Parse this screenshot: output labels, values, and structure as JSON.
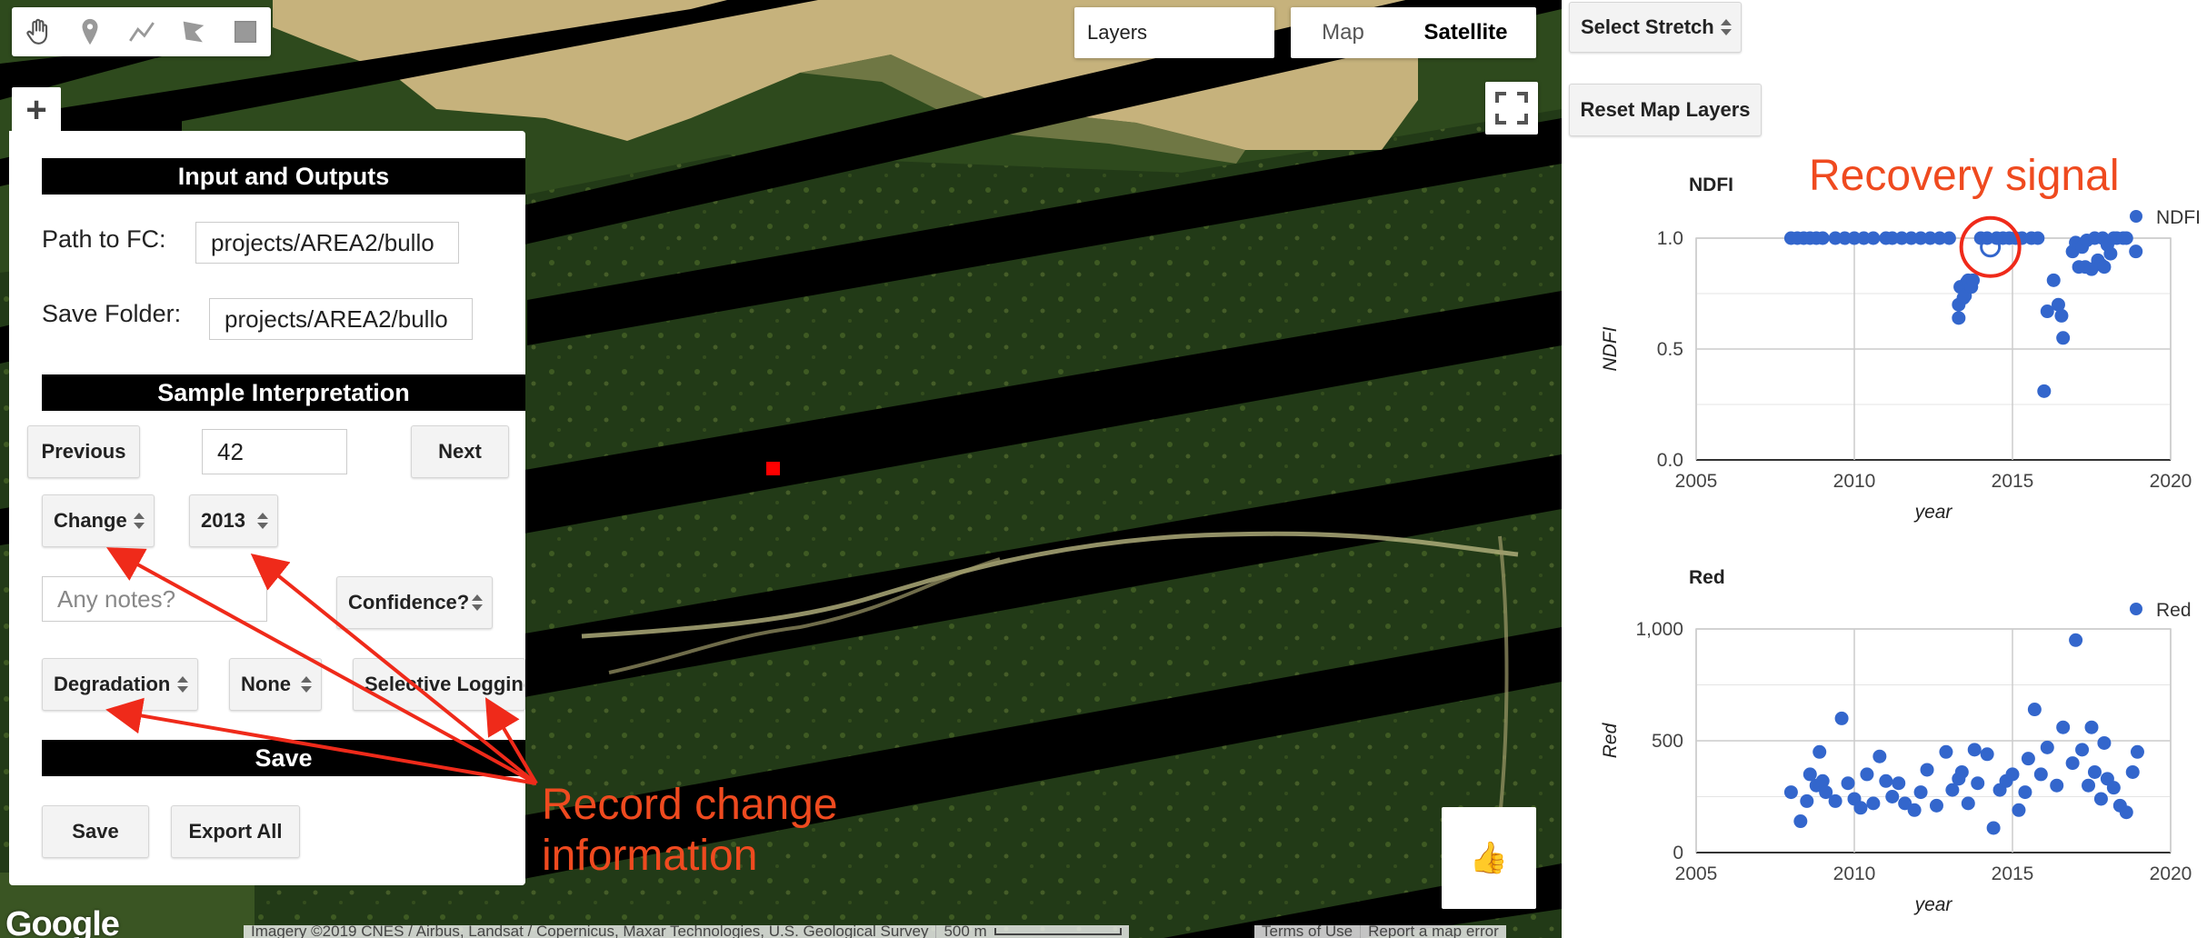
{
  "map": {
    "tools": [
      {
        "name": "hand-icon"
      },
      {
        "name": "marker-icon"
      },
      {
        "name": "line-icon"
      },
      {
        "name": "polygon-icon"
      },
      {
        "name": "rectangle-icon"
      }
    ],
    "layers_label": "Layers",
    "map_type": {
      "map_label": "Map",
      "satellite_label": "Satellite",
      "selected": "Satellite"
    },
    "plus_label": "+",
    "google_logo": "Google",
    "attribution": "Imagery ©2019 CNES / Airbus, Landsat / Copernicus, Maxar Technologies, U.S. Geological Survey",
    "scale_label": "500 m",
    "terms_label": "Terms of Use",
    "report_label": "Report a map error",
    "thumb_icon": "thumbs-up-icon"
  },
  "panel": {
    "io_header": "Input and Outputs",
    "path_label": "Path to FC:",
    "path_value": "projects/AREA2/bullo",
    "folder_label": "Save Folder:",
    "folder_value": "projects/AREA2/bullo",
    "sample_header": "Sample Interpretation",
    "prev_label": "Previous",
    "sample_index": "42",
    "next_label": "Next",
    "change_value": "Change",
    "year_value": "2013",
    "notes_placeholder": "Any notes?",
    "confidence_value": "Confidence?",
    "degradation_value": "Degradation",
    "none_value": "None",
    "selective_value": "Selective Logging",
    "save_header": "Save",
    "save_label": "Save",
    "export_label": "Export All"
  },
  "side": {
    "stretch_label": "Select Stretch",
    "reset_label": "Reset Map Layers"
  },
  "annotations": {
    "recovery": "Recovery signal",
    "record_line1": "Record change",
    "record_line2": "information"
  },
  "colors": {
    "point": "#3366cc",
    "annotation": "#ef4a1f"
  },
  "chart_data": [
    {
      "type": "scatter",
      "title": "NDFI",
      "xlabel": "year",
      "ylabel": "NDFI",
      "legend": [
        "NDFI"
      ],
      "legend_position": "top-right",
      "xlim": [
        2005,
        2020
      ],
      "ylim": [
        0,
        1
      ],
      "xticks": [
        2005,
        2010,
        2015,
        2020
      ],
      "yticks": [
        0,
        0.5,
        1.0
      ],
      "ytick_labels": [
        "0.0",
        "0.5",
        "1.0"
      ],
      "grid": true,
      "series": [
        {
          "name": "NDFI",
          "x": [
            2008.0,
            2008.2,
            2008.4,
            2008.6,
            2008.8,
            2009.0,
            2009.4,
            2009.7,
            2010.0,
            2010.3,
            2010.6,
            2011.0,
            2011.2,
            2011.5,
            2011.8,
            2012.1,
            2012.4,
            2012.7,
            2013.0,
            2013.3,
            2013.3,
            2013.35,
            2013.45,
            2013.5,
            2013.55,
            2013.6,
            2013.7,
            2013.75,
            2014.0,
            2014.2,
            2014.5,
            2014.7,
            2014.9,
            2015.1,
            2015.3,
            2015.6,
            2015.8,
            2016.0,
            2016.1,
            2016.3,
            2016.45,
            2016.55,
            2016.6,
            2016.9,
            2017.0,
            2017.1,
            2017.2,
            2017.3,
            2017.35,
            2017.5,
            2017.6,
            2017.7,
            2017.8,
            2017.85,
            2017.9,
            2018.0,
            2018.1,
            2018.2,
            2018.3,
            2018.5,
            2018.6,
            2018.9
          ],
          "y": [
            1.0,
            1.0,
            1.0,
            1.0,
            1.0,
            1.0,
            1.0,
            1.0,
            1.0,
            1.0,
            1.0,
            1.0,
            1.0,
            1.0,
            1.0,
            1.0,
            1.0,
            1.0,
            1.0,
            0.64,
            0.7,
            0.78,
            0.73,
            0.74,
            0.8,
            0.81,
            0.78,
            0.81,
            1.0,
            1.0,
            1.0,
            1.0,
            1.0,
            1.0,
            1.0,
            1.0,
            1.0,
            0.31,
            0.67,
            0.81,
            0.7,
            0.65,
            0.55,
            0.94,
            0.98,
            0.87,
            0.96,
            0.87,
            0.99,
            0.86,
            1.0,
            0.9,
            0.88,
            1.0,
            0.87,
            0.97,
            0.93,
            1.0,
            1.0,
            1.0,
            1.0,
            0.94
          ]
        }
      ]
    },
    {
      "type": "scatter",
      "title": "Red",
      "xlabel": "year",
      "ylabel": "Red",
      "legend": [
        "Red"
      ],
      "legend_position": "top-right",
      "xlim": [
        2005,
        2020
      ],
      "ylim": [
        0,
        1000
      ],
      "xticks": [
        2005,
        2010,
        2015,
        2020
      ],
      "yticks": [
        0,
        500,
        1000
      ],
      "ytick_labels": [
        "0",
        "500",
        "1,000"
      ],
      "grid": true,
      "series": [
        {
          "name": "Red",
          "x": [
            2008.0,
            2008.3,
            2008.5,
            2008.6,
            2008.8,
            2008.9,
            2009.0,
            2009.1,
            2009.4,
            2009.6,
            2009.8,
            2010.0,
            2010.2,
            2010.4,
            2010.6,
            2010.8,
            2011.0,
            2011.2,
            2011.4,
            2011.6,
            2011.9,
            2012.1,
            2012.3,
            2012.6,
            2012.9,
            2013.1,
            2013.3,
            2013.4,
            2013.6,
            2013.8,
            2013.9,
            2014.2,
            2014.4,
            2014.6,
            2014.8,
            2015.0,
            2015.2,
            2015.4,
            2015.5,
            2015.7,
            2015.9,
            2016.1,
            2016.4,
            2016.6,
            2016.9,
            2017.0,
            2017.2,
            2017.4,
            2017.5,
            2017.6,
            2017.8,
            2017.9,
            2018.0,
            2018.2,
            2018.4,
            2018.6,
            2018.8,
            2018.95
          ],
          "y": [
            270,
            140,
            230,
            350,
            300,
            450,
            320,
            270,
            230,
            600,
            310,
            240,
            200,
            350,
            220,
            430,
            320,
            250,
            310,
            220,
            190,
            270,
            370,
            210,
            450,
            280,
            330,
            360,
            220,
            460,
            310,
            440,
            110,
            280,
            320,
            350,
            190,
            270,
            420,
            640,
            350,
            470,
            300,
            560,
            400,
            950,
            460,
            300,
            560,
            360,
            240,
            490,
            330,
            290,
            210,
            180,
            360,
            450
          ]
        }
      ]
    }
  ]
}
